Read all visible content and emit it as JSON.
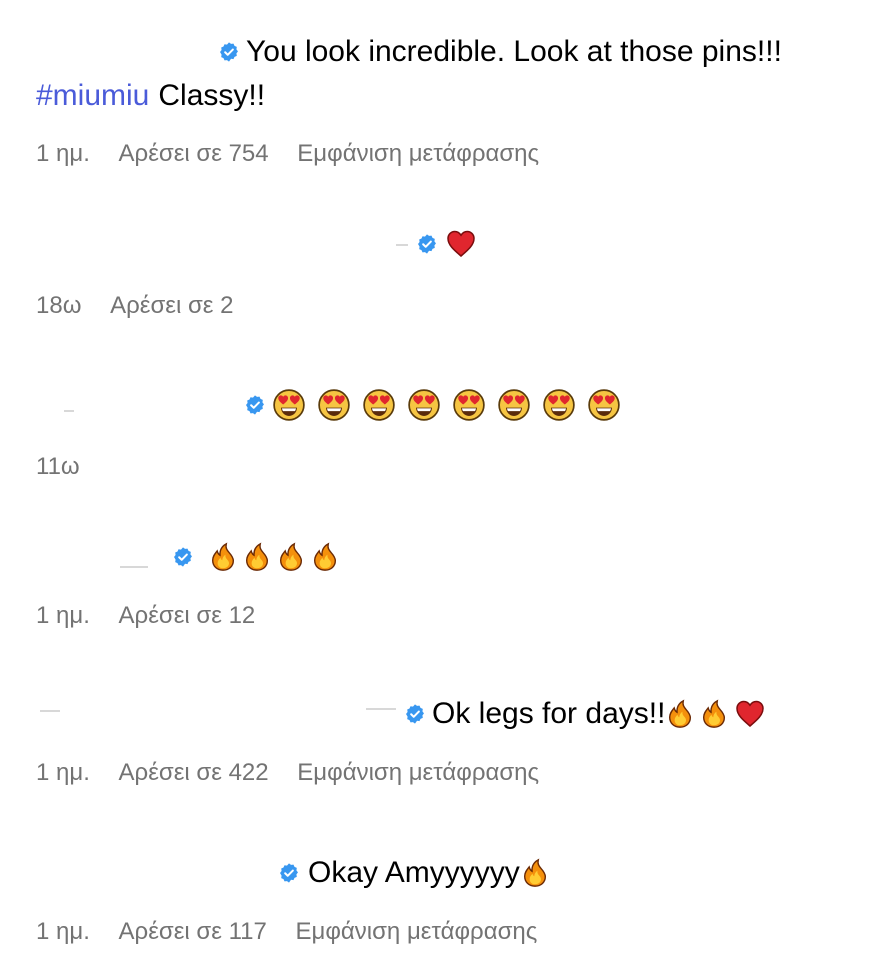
{
  "comments": [
    {
      "text": "You look incredible. Look at those pins!!!",
      "hashtag": "#miumiu",
      "text_after": "Classy!!",
      "meta": {
        "time": "1 ημ.",
        "likes": "Αρέσει σε 754",
        "translate": "Εμφάνιση μετάφρασης"
      }
    },
    {
      "emojis": [
        "red-heart"
      ],
      "meta": {
        "time": "18ω",
        "likes": "Αρέσει σε 2"
      }
    },
    {
      "emojis": [
        "heart-eyes",
        "heart-eyes",
        "heart-eyes",
        "heart-eyes",
        "heart-eyes",
        "heart-eyes",
        "heart-eyes",
        "heart-eyes"
      ],
      "meta": {
        "time": "11ω"
      }
    },
    {
      "emojis": [
        "fire",
        "fire",
        "fire",
        "fire"
      ],
      "meta": {
        "time": "1 ημ.",
        "likes": "Αρέσει σε 12"
      }
    },
    {
      "text": "Ok legs for days!!",
      "emojis": [
        "fire",
        "fire",
        "red-heart"
      ],
      "meta": {
        "time": "1 ημ.",
        "likes": "Αρέσει σε 422",
        "translate": "Εμφάνιση μετάφρασης"
      }
    },
    {
      "text": "Okay Amyyyyyy",
      "emojis": [
        "fire"
      ],
      "meta": {
        "time": "1 ημ.",
        "likes": "Αρέσει σε 117",
        "translate": "Εμφάνιση μετάφρασης"
      }
    }
  ],
  "colors": {
    "verified": "#3897f0",
    "hashtag": "#4a5bd9",
    "meta": "#737373"
  }
}
